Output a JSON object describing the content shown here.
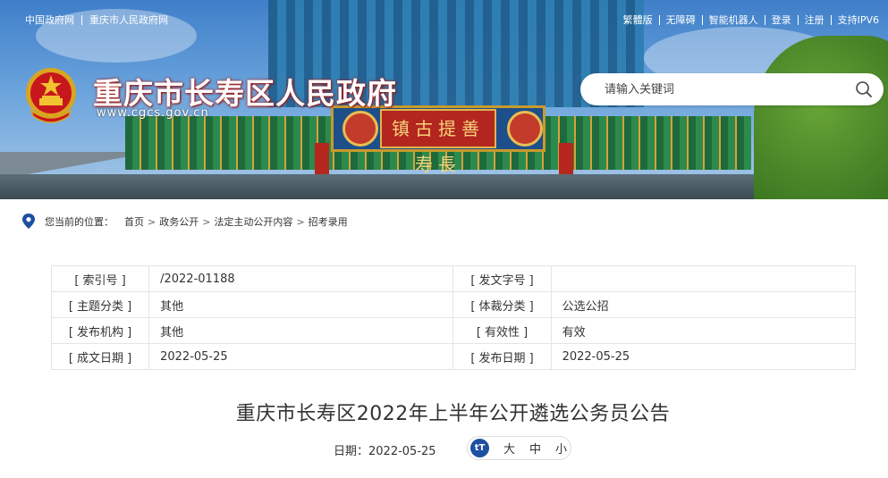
{
  "top_links_left": [
    "中国政府网",
    "重庆市人民政府网"
  ],
  "top_links_right": [
    "繁體版",
    "无障碍",
    "智能机器人",
    "登录",
    "注册",
    "支持IPV6"
  ],
  "site": {
    "title": "重庆市长寿区人民政府",
    "url": "www.cgcs.gov.cn",
    "plaque": "镇古提善寿長"
  },
  "search": {
    "placeholder": "请输入关键词",
    "icon": "search-icon"
  },
  "breadcrumb": {
    "prefix": "您当前的位置：",
    "items": [
      "首页",
      "政务公开",
      "法定主动公开内容",
      "招考录用"
    ],
    "separator": ">"
  },
  "meta": {
    "rows": [
      {
        "k1": "[ 索引号 ]",
        "v1": "/2022-01188",
        "k2": "[ 发文字号 ]",
        "v2": ""
      },
      {
        "k1": "[ 主题分类 ]",
        "v1": "其他",
        "k2": "[ 体裁分类 ]",
        "v2": "公选公招"
      },
      {
        "k1": "[ 发布机构 ]",
        "v1": "其他",
        "k2": "[ 有效性 ]",
        "v2": "有效"
      },
      {
        "k1": "[ 成文日期 ]",
        "v1": "2022-05-25",
        "k2": "[ 发布日期 ]",
        "v2": "2022-05-25"
      }
    ]
  },
  "article": {
    "title": "重庆市长寿区2022年上半年公开遴选公务员公告",
    "date_label": "日期：",
    "date": "2022-05-25",
    "font_sizes": [
      "大",
      "中",
      "小"
    ]
  },
  "colors": {
    "title_shadow": "#b01a15",
    "accent": "#1e4fa0"
  }
}
